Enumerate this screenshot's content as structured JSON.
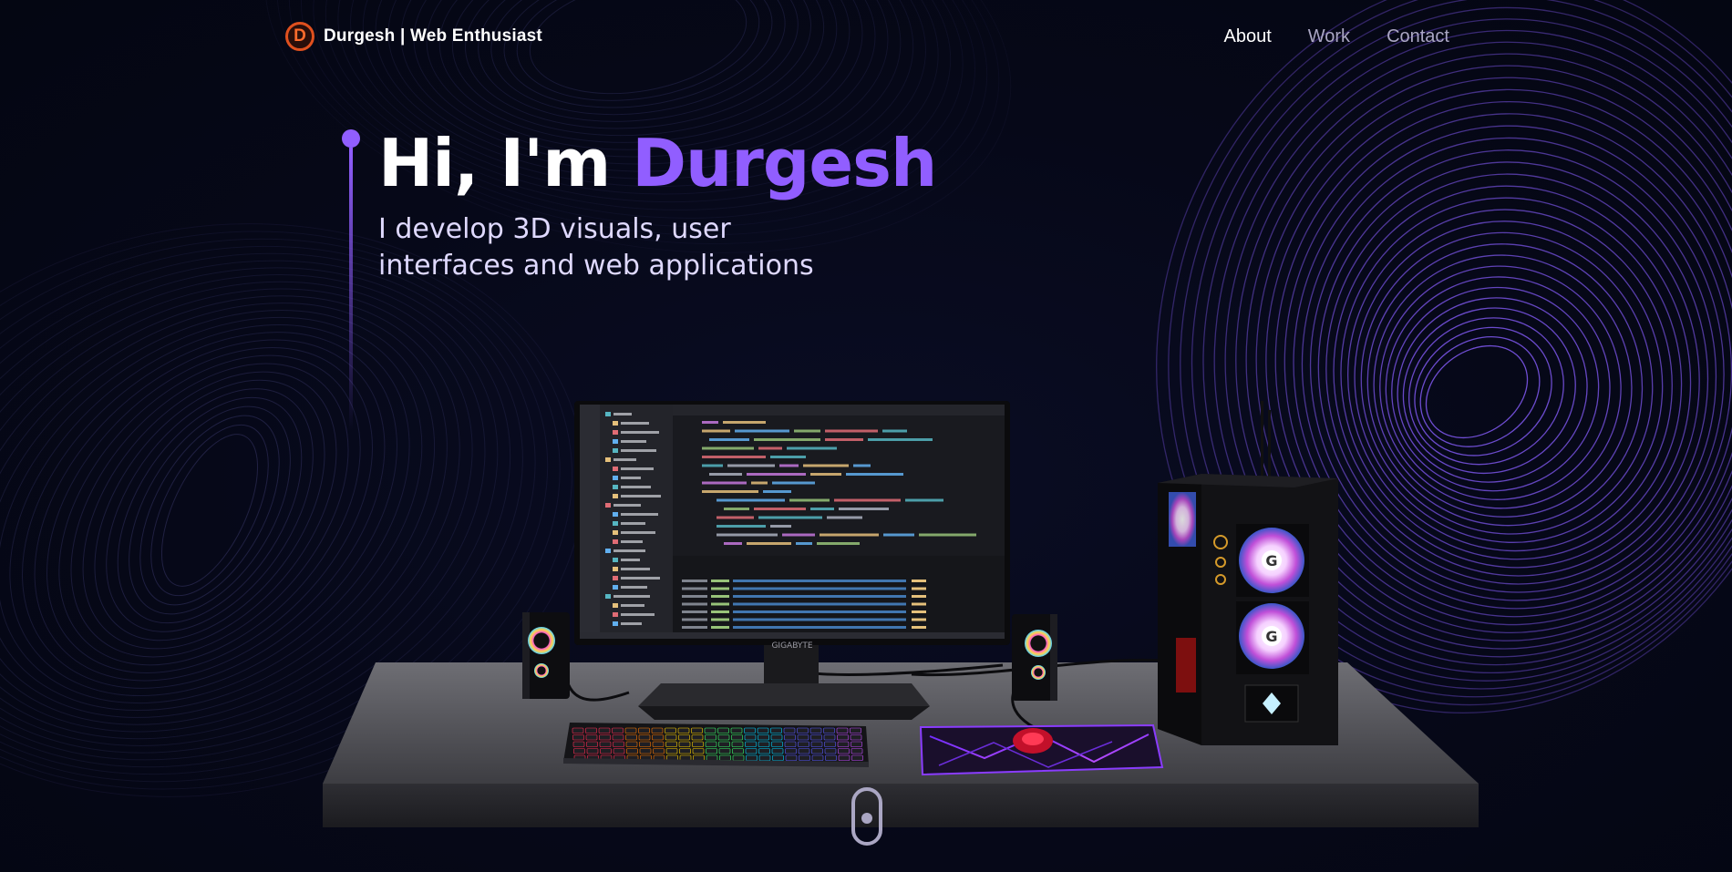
{
  "nav": {
    "logo_letter": "D",
    "brand": "Durgesh | Web Enthusiast",
    "links": [
      {
        "label": "About",
        "active": true
      },
      {
        "label": "Work",
        "active": false
      },
      {
        "label": "Contact",
        "active": false
      }
    ]
  },
  "hero": {
    "greeting": "Hi, I'm ",
    "name": "Durgesh",
    "tagline": "I develop 3D visuals, user interfaces and web applications"
  },
  "scene": {
    "monitor_brand": "GIGABYTE"
  },
  "colors": {
    "accent": "#915eff",
    "background": "#050816",
    "logo": "#e0501e"
  }
}
